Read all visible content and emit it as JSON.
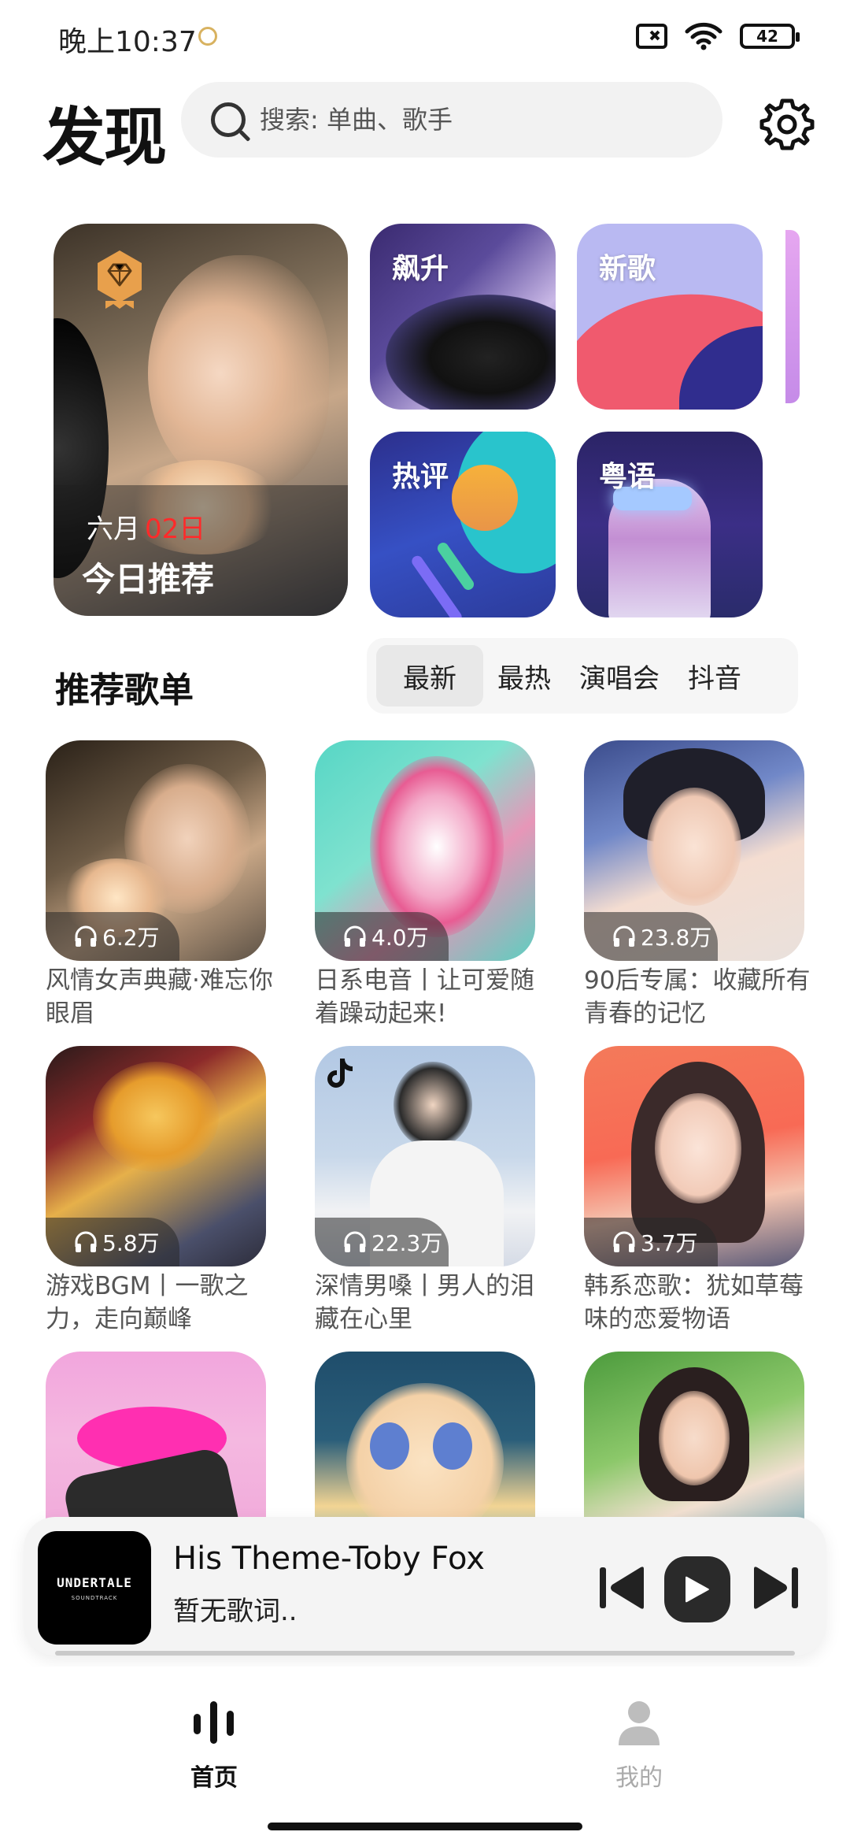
{
  "status_bar": {
    "time": "晚上10:37",
    "battery": "42"
  },
  "header": {
    "title": "发现",
    "search_placeholder": "搜索: 单曲、歌手"
  },
  "featured": {
    "today": {
      "month": "六月",
      "day": "02日",
      "title": "今日推荐"
    },
    "tiles": [
      {
        "label": "飙升"
      },
      {
        "label": "新歌"
      },
      {
        "label": "热评"
      },
      {
        "label": "粤语"
      }
    ]
  },
  "playlists_section": {
    "title": "推荐歌单",
    "tabs": [
      "最新",
      "最热",
      "演唱会",
      "抖音"
    ],
    "active_tab": "最新"
  },
  "playlists": [
    {
      "plays": "6.2万",
      "name": "风情女声典藏·难忘你眼眉"
    },
    {
      "plays": "4.0万",
      "name": "日系电音丨让可爱随着躁动起来!"
    },
    {
      "plays": "23.8万",
      "name": "90后专属：收藏所有青春的记忆"
    },
    {
      "plays": "5.8万",
      "name": "游戏BGM丨一歌之力，走向巅峰"
    },
    {
      "plays": "22.3万",
      "name": "深情男嗓丨男人的泪藏在心里"
    },
    {
      "plays": "3.7万",
      "name": "韩系恋歌：犹如草莓味的恋爱物语"
    },
    {
      "plays": "",
      "name": ""
    },
    {
      "plays": "",
      "name": ""
    },
    {
      "plays": "",
      "name": ""
    }
  ],
  "player": {
    "album_text": "UNDERTALE",
    "album_subtext": "SOUNDTRACK",
    "track": "His Theme-Toby Fox",
    "lyric": "暂无歌词.."
  },
  "bottom_nav": {
    "home": "首页",
    "mine": "我的"
  },
  "colors": {
    "accent_red": "#ff2a2a",
    "search_bg": "#f2f2f2",
    "player_bg": "#f4f4f4"
  }
}
